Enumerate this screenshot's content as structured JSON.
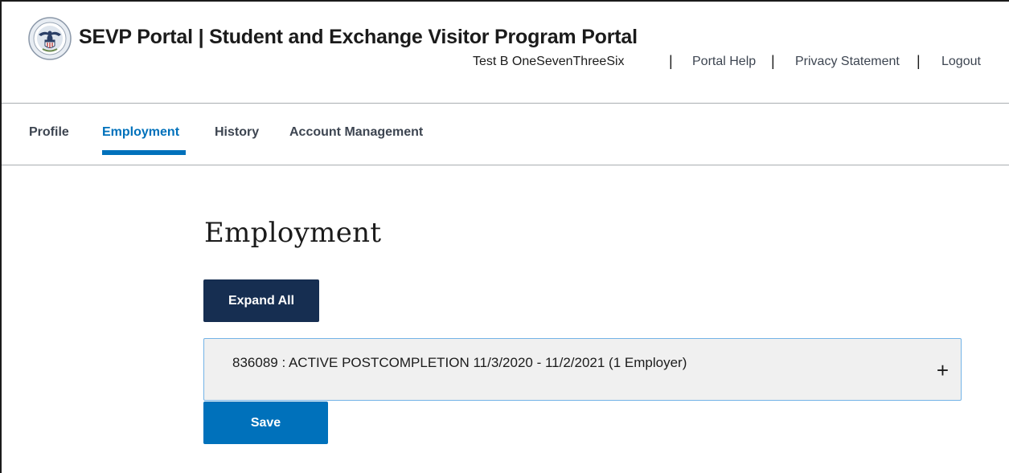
{
  "header": {
    "site_title": "SEVP Portal | Student and Exchange Visitor Program Portal",
    "user_name": "Test B OneSevenThreeSix",
    "separator": "|",
    "links": {
      "portal_help": "Portal Help",
      "privacy_statement": "Privacy Statement",
      "logout": "Logout"
    }
  },
  "tabs": [
    {
      "label": "Profile",
      "active": false
    },
    {
      "label": "Employment",
      "active": true
    },
    {
      "label": "History",
      "active": false
    },
    {
      "label": "Account Management",
      "active": false
    }
  ],
  "main": {
    "title": "Employment",
    "expand_all_label": "Expand All",
    "accordion": {
      "label": "836089 : ACTIVE POSTCOMPLETION 11/3/2020 - 11/2/2021 (1 Employer)",
      "toggle_icon": "plus-icon",
      "toggle_glyph": "+"
    },
    "save_label": "Save"
  },
  "colors": {
    "primary_blue": "#0071bb",
    "dark_navy": "#162e51",
    "accordion_bg": "#f0f0f0",
    "accordion_border": "#73b3e7"
  }
}
